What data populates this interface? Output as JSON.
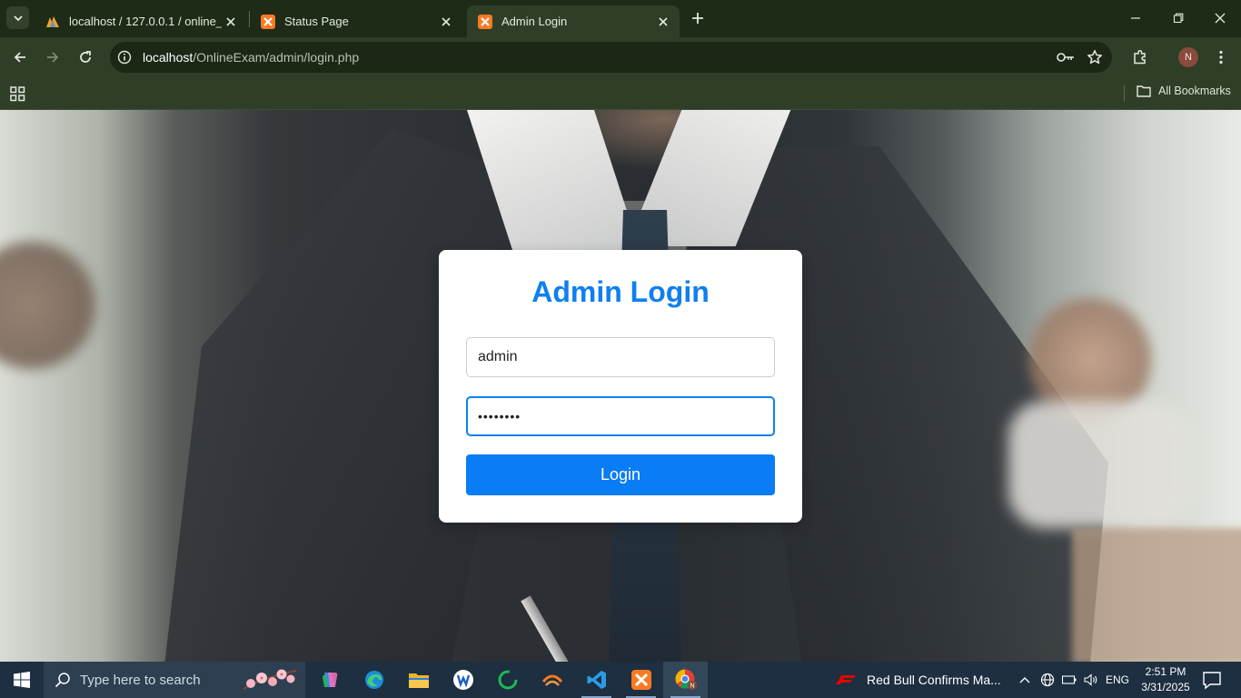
{
  "browser": {
    "tabs": [
      {
        "title": "localhost / 127.0.0.1 / online_ex",
        "favicon": "phpmyadmin-icon",
        "active": false
      },
      {
        "title": "Status Page",
        "favicon": "xampp-icon",
        "active": false
      },
      {
        "title": "Admin Login",
        "favicon": "xampp-icon",
        "active": true
      }
    ],
    "url_host": "localhost",
    "url_path": "/OnlineExam/admin/login.php",
    "profile_initial": "N",
    "all_bookmarks_label": "All Bookmarks"
  },
  "page": {
    "title": "Admin Login",
    "username_value": "admin",
    "password_value": "••••••••",
    "login_label": "Login",
    "accent_color": "#0f7ff0"
  },
  "taskbar": {
    "search_placeholder": "Type here to search",
    "news_text": "Red Bull Confirms Ma...",
    "language": "ENG",
    "time": "2:51 PM",
    "date": "3/31/2025"
  }
}
